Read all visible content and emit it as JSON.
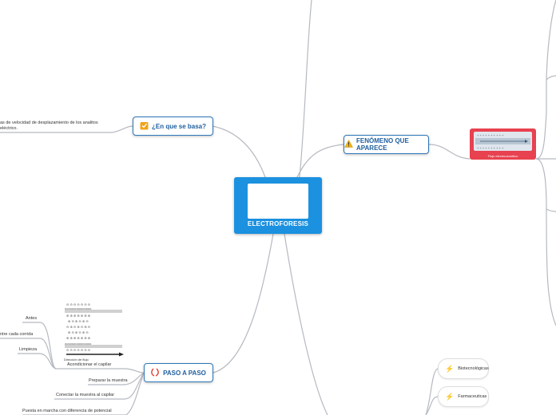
{
  "central": {
    "title": "ELECTROFORESIS"
  },
  "topics": {
    "basa": {
      "label": "¿En que se basa?",
      "icon": "notepad-icon"
    },
    "fenomeno": {
      "label": "FENÓMENO QUE APARECE",
      "icon": "warning-icon"
    },
    "paso": {
      "label": "PASO A PASO",
      "icon": "arrows-icon"
    }
  },
  "basa_text": {
    "line1": "as de velocidad de desplazamiento de los analitos",
    "line2": "eléctrico."
  },
  "fenomeno_image": {
    "caption": "Flujo electroosmótico"
  },
  "paso": {
    "image_caption": "Dirección de flujo",
    "steps": [
      {
        "key": "acondicionar",
        "label": "Acondicionar el capilar"
      },
      {
        "key": "preparar",
        "label": "Preparar la muestra"
      },
      {
        "key": "conectar",
        "label": "Conectar la muestra al capilar"
      },
      {
        "key": "puesta",
        "label": "Puesta en marcha con diferencia de potencial"
      }
    ],
    "substeps": [
      {
        "key": "antes",
        "label": "Antes"
      },
      {
        "key": "entre",
        "label": "ntre cada corrida"
      },
      {
        "key": "limpieza",
        "label": "Limpieza"
      }
    ]
  },
  "applications": [
    {
      "key": "biotec",
      "label": "Biotecnológicas",
      "icon": "lightning-icon"
    },
    {
      "key": "farma",
      "label": "Farmaceuticas",
      "icon": "lightning-icon"
    }
  ],
  "colors": {
    "accent": "#1b91e0",
    "topic_border": "#2e77b8",
    "connector": "#b5b9c0",
    "fenomeno_image_bg": "#e8414f",
    "bolt": "#f4b400"
  }
}
